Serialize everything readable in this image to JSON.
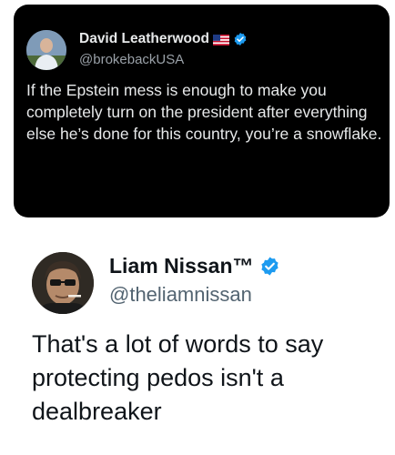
{
  "colors": {
    "dark_background": "#000000",
    "dark_text": "#e7e9ea",
    "dark_secondary": "#9aa1a8",
    "light_background": "#ffffff",
    "light_text": "#0f1419",
    "light_secondary": "#536471",
    "verified_blue": "#1d9bf0"
  },
  "top_tweet": {
    "author_name": "David Leatherwood",
    "flag_icon": "us-flag-icon",
    "verified_icon": "verified-badge-icon",
    "handle": "@brokebackUSA",
    "text": "If the Epstein mess is enough to make you completely turn on the president after everything else he’s done for this country, you’re a snowflake."
  },
  "bottom_tweet": {
    "author_name": "Liam Nissan™",
    "verified_icon": "verified-badge-icon",
    "handle": "@theliamnissan",
    "text": "That's a lot of words to say protecting pedos isn't a dealbreaker"
  }
}
